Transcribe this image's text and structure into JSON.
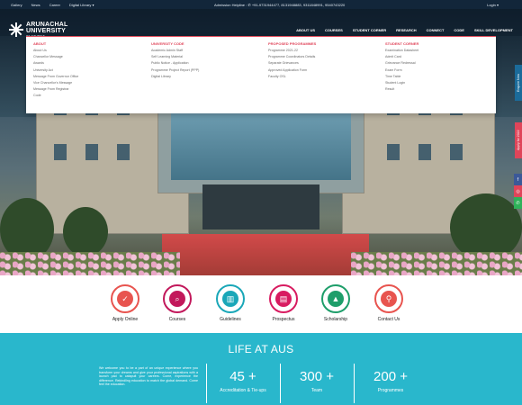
{
  "topbar": {
    "links": [
      "Gallery",
      "News",
      "Career",
      "Digital Library ▾"
    ],
    "helpline": "Admission Helpline : ✆ +91-9731944477, 8131948883, 9311848991, 9540743220",
    "login": "Login ▾"
  },
  "logo": {
    "line1": "ARUNACHAL",
    "line2": "UNIVERSITY",
    "line3": "OF STUDIES"
  },
  "nav": [
    "ABOUT US",
    "COURSES",
    "STUDENT CORNER",
    "RESEARCH",
    "CONNECT",
    "CODE",
    "SKILL DEVELOPMENT"
  ],
  "mega": [
    {
      "title": "ABOUT",
      "items": [
        "About Us",
        "Chancellor Message",
        "Awards",
        "University Act",
        "Message From Governor Office",
        "Vice Chancellor's Message",
        "Message From Registrar",
        "Code"
      ]
    },
    {
      "title": "UNIVERSITY CODE",
      "items": [
        "Academic Admin Staff",
        "Self Learning Material",
        "Public Notice - Application",
        "Programme Project Report (PPP)",
        "Digital Library"
      ]
    },
    {
      "title": "PROPOSED PROGRAMMES",
      "items": [
        "Programme 2021-22",
        "Programme Coordinators Details",
        "Separate Grievances",
        "Approved Application Form",
        "Faculty OSL"
      ]
    },
    {
      "title": "STUDENT CORNER",
      "items": [
        "Examination Datasheet",
        "Admit Card",
        "Grievance Redressal",
        "Exam Form",
        "Time Table",
        "Student Login",
        "Result"
      ]
    }
  ],
  "side": {
    "enquire": "Enquire Now",
    "apply": "Apply for 2022"
  },
  "quick_links": [
    {
      "label": "Apply Online",
      "icon": "check-icon",
      "color": "#e8544f"
    },
    {
      "label": "Courses",
      "icon": "search-icon",
      "color": "#c2185b"
    },
    {
      "label": "Guidelines",
      "icon": "building-icon",
      "color": "#1aa7b8"
    },
    {
      "label": "Prospectus",
      "icon": "document-icon",
      "color": "#d81b60"
    },
    {
      "label": "Scholarship",
      "icon": "graduation-cap-icon",
      "color": "#1e9e6a"
    },
    {
      "label": "Contact Us",
      "icon": "location-pin-icon",
      "color": "#e8544f"
    }
  ],
  "life": {
    "title": "LIFE AT AUS",
    "paragraph": "We welcome you to be a part of an unique experience where you transform your dreams and give your professional aspirations with a launch pad to catapult your careers. Come, experience the difference. Rekindling education to match the global demand. Come feel the education.",
    "stats": [
      {
        "number": "45 +",
        "caption": "Accreditation & Tie-ups"
      },
      {
        "number": "300 +",
        "caption": "Team"
      },
      {
        "number": "200 +",
        "caption": "Programmes"
      }
    ]
  }
}
